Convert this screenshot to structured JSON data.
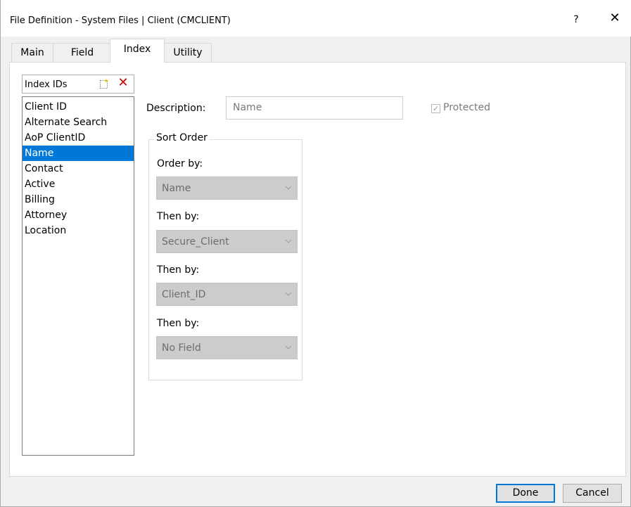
{
  "window": {
    "title": "File Definition - System Files | Client (CMCLIENT)",
    "help_label": "?",
    "close_label": "✕"
  },
  "tabs": [
    {
      "label": "Main",
      "active": false
    },
    {
      "label": "Field",
      "active": false
    },
    {
      "label": "Index",
      "active": true
    },
    {
      "label": "Utility",
      "active": false
    }
  ],
  "index_ids": {
    "header": "Index IDs",
    "new_icon": "new-item-icon",
    "delete_icon": "delete-x-icon",
    "delete_glyph": "✕",
    "delete_color": "#cc0000",
    "items": [
      {
        "label": "Client ID"
      },
      {
        "label": "Alternate Search"
      },
      {
        "label": "AoP ClientID"
      },
      {
        "label": "Name"
      },
      {
        "label": "Contact"
      },
      {
        "label": "Active"
      },
      {
        "label": "Billing"
      },
      {
        "label": "Attorney"
      },
      {
        "label": "Location"
      }
    ],
    "selected": "Name",
    "selection_color": "#0078d7"
  },
  "description": {
    "label": "Description:",
    "value": "Name"
  },
  "protected": {
    "label": "Protected",
    "checked": true,
    "disabled": true,
    "check_glyph": "✓"
  },
  "sort_order": {
    "legend": "Sort Order",
    "fields": [
      {
        "label": "Order by:",
        "value": "Name"
      },
      {
        "label": "Then by:",
        "value": "Secure_Client"
      },
      {
        "label": "Then by:",
        "value": "Client_ID"
      },
      {
        "label": "Then by:",
        "value": "No Field"
      }
    ]
  },
  "buttons": {
    "done": "Done",
    "cancel": "Cancel"
  }
}
